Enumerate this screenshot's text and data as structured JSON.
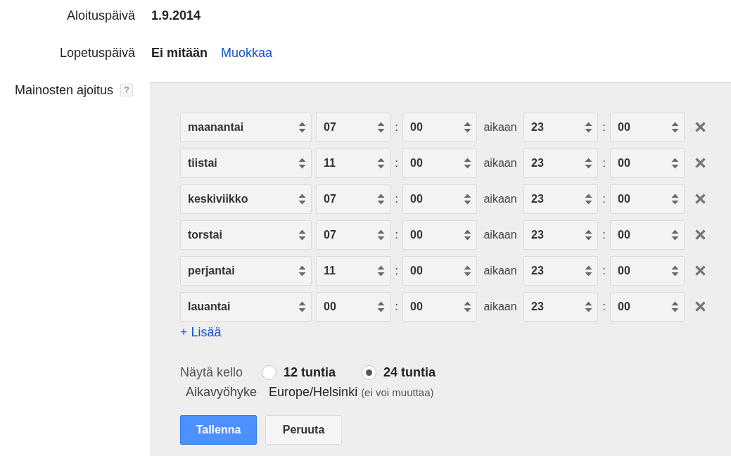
{
  "fields": [
    {
      "label": "Aloituspäivä",
      "value": "1.9.2014"
    },
    {
      "label": "Lopetuspäivä",
      "value": "Ei mitään",
      "link": "Muokkaa"
    }
  ],
  "ad_schedule": {
    "label": "Mainosten ajoitus",
    "help": "?",
    "rows": [
      {
        "day": "maanantai",
        "start_hour": "07",
        "start_colon": ":",
        "start_minute": "00",
        "until": "aikaan",
        "end_hour": "23",
        "end_colon": ":",
        "end_minute": "00"
      },
      {
        "day": "tiistai",
        "start_hour": "11",
        "start_colon": ":",
        "start_minute": "00",
        "until": "aikaan",
        "end_hour": "23",
        "end_colon": ":",
        "end_minute": "00"
      },
      {
        "day": "keskiviikko",
        "start_hour": "07",
        "start_colon": ":",
        "start_minute": "00",
        "until": "aikaan",
        "end_hour": "23",
        "end_colon": ":",
        "end_minute": "00"
      },
      {
        "day": "torstai",
        "start_hour": "07",
        "start_colon": ":",
        "start_minute": "00",
        "until": "aikaan",
        "end_hour": "23",
        "end_colon": ":",
        "end_minute": "00"
      },
      {
        "day": "perjantai",
        "start_hour": "11",
        "start_colon": ":",
        "start_minute": "00",
        "until": "aikaan",
        "end_hour": "23",
        "end_colon": ":",
        "end_minute": "00"
      },
      {
        "day": "lauantai",
        "start_hour": "00",
        "start_colon": ":",
        "start_minute": "00",
        "until": "aikaan",
        "end_hour": "23",
        "end_colon": ":",
        "end_minute": "00"
      }
    ],
    "add_link": "+ Lisää",
    "clock": {
      "label": "Näytä kello",
      "options": [
        {
          "label": "12 tuntia",
          "selected": false
        },
        {
          "label": "24 tuntia",
          "selected": true
        }
      ]
    },
    "time_zone": {
      "label": "Aikavyöhyke",
      "value": "Europe/Helsinki",
      "note": "(ei voi muuttaa)"
    },
    "buttons": [
      {
        "label": "Tallenna",
        "kind": "primary"
      },
      {
        "label": "Peruuta",
        "kind": "secondary"
      }
    ]
  }
}
